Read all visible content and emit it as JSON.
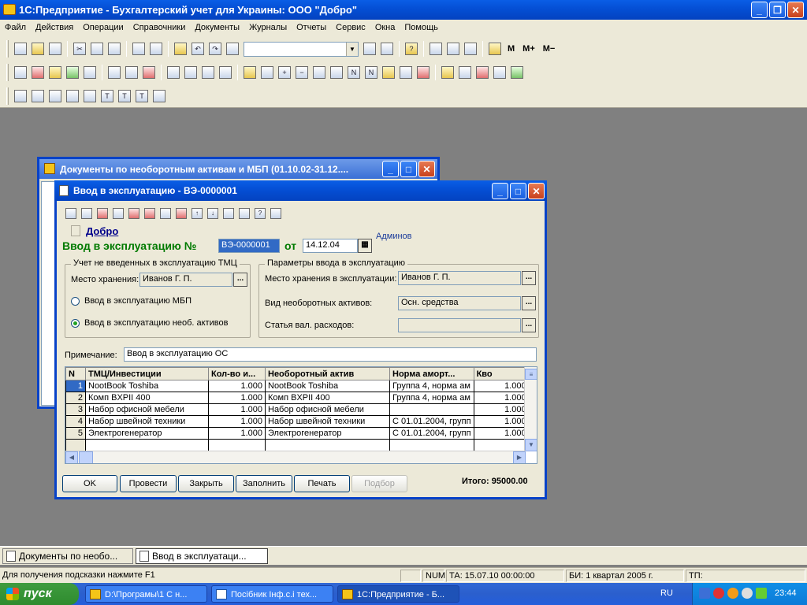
{
  "app": {
    "title": "1С:Предприятие - Бухгалтерский учет для Украины: ООО \"Добро\"",
    "menu": [
      "Файл",
      "Действия",
      "Операции",
      "Справочники",
      "Документы",
      "Журналы",
      "Отчеты",
      "Сервис",
      "Окна",
      "Помощь"
    ],
    "toolbar_text": [
      "M",
      "M+",
      "M−"
    ]
  },
  "back_window": {
    "title": "Документы по необоротным активам и МБП (01.10.02-31.12...."
  },
  "doc": {
    "title": "Ввод в эксплуатацию - ВЭ-0000001",
    "org_link": "Добро",
    "heading": "Ввод в эксплуатацию №",
    "number": "ВЭ-0000001",
    "from_label": "от",
    "date": "14.12.04",
    "author": "Админов",
    "left_group": {
      "caption": "Учет не введенных в эксплуатацию ТМЦ",
      "storage_label": "Место хранения:",
      "storage_value": "Иванов Г. П.",
      "radio1": "Ввод в эксплуатацию МБП",
      "radio2": "Ввод в эксплуатацию необ. активов"
    },
    "right_group": {
      "caption": "Параметры ввода в эксплуатацию",
      "storage_label": "Место хранения в эксплуатации:",
      "storage_value": "Иванов Г. П.",
      "kind_label": "Вид необоротных активов:",
      "kind_value": "Осн. средства",
      "expense_label": "Статья вал. расходов:",
      "expense_value": ""
    },
    "note_label": "Примечание:",
    "note_value": "Ввод в эксплуатацию ОС",
    "table": {
      "columns": [
        "N",
        "ТМЦ/Инвестиции",
        "Кол-во и...",
        "Необоротный актив",
        "Норма аморт...",
        "Кво"
      ],
      "rows": [
        {
          "n": "1",
          "item": "NootBook Toshiba",
          "qty": "1.000",
          "asset": "NootBook Toshiba",
          "norm": "Группа 4, норма ам",
          "kvo": "1.000"
        },
        {
          "n": "2",
          "item": "Комп BXPII 400",
          "qty": "1.000",
          "asset": "Комп BXPII 400",
          "norm": "Группа 4, норма ам",
          "kvo": "1.000"
        },
        {
          "n": "3",
          "item": "Набор офисной мебели",
          "qty": "1.000",
          "asset": "Набор офисной мебели",
          "norm": "",
          "kvo": "1.000"
        },
        {
          "n": "4",
          "item": "Набор швейной техники",
          "qty": "1.000",
          "asset": "Набор швейной техники",
          "norm": "С 01.01.2004, групп",
          "kvo": "1.000"
        },
        {
          "n": "5",
          "item": "Электрогенератор",
          "qty": "1.000",
          "asset": "Электрогенератор",
          "norm": "С 01.01.2004, групп",
          "kvo": "1.000"
        }
      ]
    },
    "buttons": {
      "ok": "OK",
      "post": "Провести",
      "close": "Закрыть",
      "fill": "Заполнить",
      "print": "Печать",
      "pick": "Подбор"
    },
    "total": "Итого: 95000.00"
  },
  "mdi_tabs": [
    "Документы по необо...",
    "Ввод в эксплуатаци..."
  ],
  "status": {
    "hint": "Для получения подсказки нажмите F1",
    "num": "NUM",
    "ta": "ТА: 15.07.10  00:00:00",
    "bi": "БИ: 1 квартал 2005 г.",
    "tp": "ТП:"
  },
  "taskbar": {
    "start": "пуск",
    "tasks": [
      "D:\\Програмы\\1 С н...",
      "Посібник Інф.с.і тех...",
      "1С:Предприятие - Б..."
    ],
    "lang": "RU",
    "time": "23:44"
  }
}
